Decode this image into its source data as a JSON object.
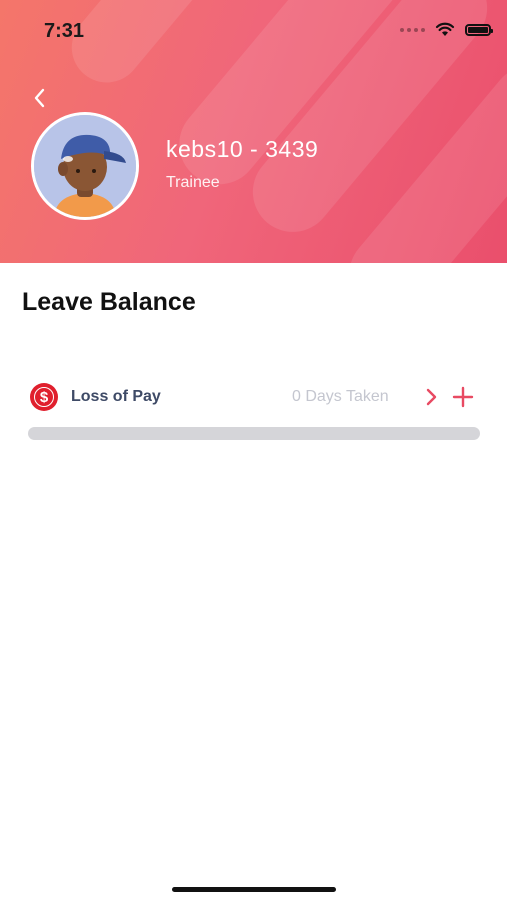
{
  "status_bar": {
    "time": "7:31"
  },
  "header": {
    "back_icon": "chevron-left-icon",
    "avatar": "avatar-image",
    "user_name": "kebs10 - 3439",
    "user_role": "Trainee",
    "gradient_colors": [
      "#f4766a",
      "#ea4f6c"
    ]
  },
  "leave_balance": {
    "title": "Leave Balance",
    "items": [
      {
        "icon": "dollar-icon",
        "icon_color": "#e01f2d",
        "name": "Loss of Pay",
        "taken_text": "0 Days Taken",
        "progress": 0
      }
    ]
  },
  "accent_color": "#e84a62"
}
